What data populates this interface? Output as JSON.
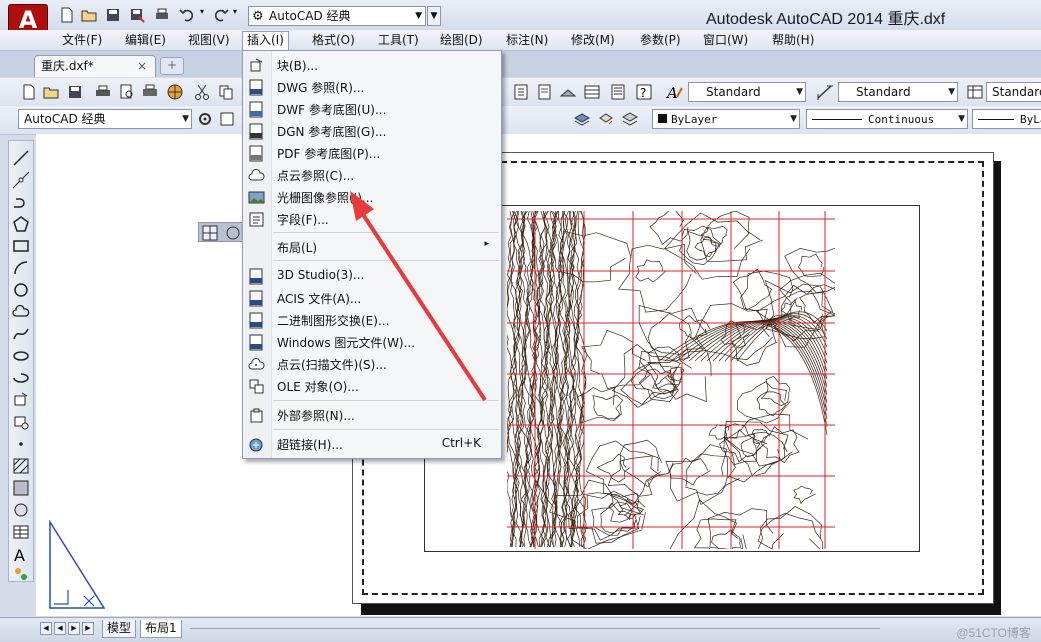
{
  "app": {
    "logo_letter": "A",
    "title": "Autodesk AutoCAD 2014   重庆.dxf",
    "workspace": "AutoCAD 经典"
  },
  "menubar": {
    "items": [
      "文件(F)",
      "编辑(E)",
      "视图(V)",
      "插入(I)",
      "格式(O)",
      "工具(T)",
      "绘图(D)",
      "标注(N)",
      "修改(M)",
      "参数(P)",
      "窗口(W)",
      "帮助(H)"
    ],
    "active": "插入(I)"
  },
  "tabs": {
    "document": "重庆.dxf*",
    "close": "×"
  },
  "toolbar": {
    "text_style": "Standard",
    "dim_style": "Standard",
    "table_style": "Standard",
    "workspace_combo": "AutoCAD 经典",
    "color": "ByLayer",
    "linetype": "Continuous",
    "lineweight": "ByLa"
  },
  "insert_menu": {
    "items": [
      {
        "label": "块(B)...",
        "icon": "block-icon"
      },
      {
        "label": "DWG 参照(R)...",
        "icon": "dwg-icon"
      },
      {
        "label": "DWF 参考底图(U)...",
        "icon": "dwf-icon"
      },
      {
        "label": "DGN 参考底图(G)...",
        "icon": "dgn-icon"
      },
      {
        "label": "PDF 参考底图(P)...",
        "icon": "pdf-icon"
      },
      {
        "label": "点云参照(C)...",
        "icon": "point-cloud-icon"
      },
      {
        "label": "光栅图像参照(I)...",
        "icon": "raster-image-icon"
      },
      {
        "label": "字段(F)...",
        "icon": "field-icon"
      },
      {
        "label": "布局(L)",
        "icon": ""
      },
      {
        "label": "3D Studio(3)...",
        "icon": "3ds-icon"
      },
      {
        "label": "ACIS 文件(A)...",
        "icon": "acis-icon"
      },
      {
        "label": "二进制图形交换(E)...",
        "icon": "dxb-icon"
      },
      {
        "label": "Windows 图元文件(W)...",
        "icon": "wmf-icon"
      },
      {
        "label": "点云(扫描文件)(S)...",
        "icon": "point-cloud-scan-icon"
      },
      {
        "label": "OLE 对象(O)...",
        "icon": "ole-icon"
      },
      {
        "label": "外部参照(N)...",
        "icon": "xref-icon"
      },
      {
        "label": "超链接(H)...",
        "icon": "hyperlink-icon"
      }
    ],
    "hyperlink_shortcut": "Ctrl+K",
    "submenu_arrow": "▸"
  },
  "layout_tabs": {
    "model": "模型",
    "layout1": "布局1"
  },
  "watermark": "@51CTO博客",
  "colors": {
    "menu_highlight": "#8d9cc0",
    "grid_red": "#e0202a",
    "contour_brown": "#3a2412",
    "arrow_red": "#e83a3a"
  }
}
